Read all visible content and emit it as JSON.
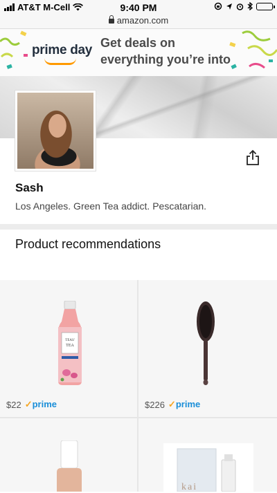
{
  "status_bar": {
    "carrier": "AT&T M-Cell",
    "time": "9:40 PM"
  },
  "browser": {
    "url": "amazon.com"
  },
  "banner": {
    "logo_text": "prime day",
    "headline_line1": "Get deals on",
    "headline_line2": "everything you’re into"
  },
  "profile": {
    "name": "Sash",
    "bio": "Los Angeles. Green Tea addict. Pescatarian."
  },
  "recommendations": {
    "title": "Product recommendations",
    "items": [
      {
        "price": "$22",
        "badge": "prime",
        "product_icon": "tea-bottle-icon"
      },
      {
        "price": "$226",
        "badge": "prime",
        "product_icon": "hair-brush-icon"
      },
      {
        "price": "",
        "badge": "",
        "product_icon": "nail-polish-icon"
      },
      {
        "price": "",
        "badge": "",
        "product_icon": "skincare-box-icon",
        "label": "kai"
      }
    ]
  },
  "colors": {
    "prime_blue": "#1a8ed8",
    "prime_check": "#f5a623",
    "smile_orange": "#ff9900"
  }
}
